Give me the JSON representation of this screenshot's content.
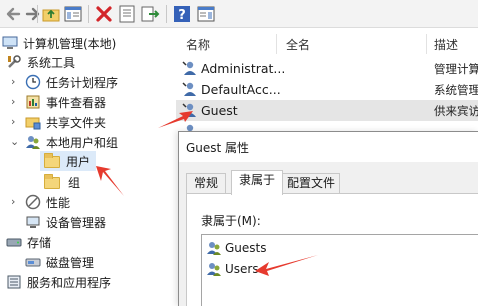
{
  "toolbar": {
    "icons": [
      "back-icon",
      "forward-icon",
      "up-folder-icon",
      "show-hide-tree-icon",
      "delete-icon",
      "properties-icon",
      "export-list-icon",
      "help-icon",
      "show-hide-action-pane-icon"
    ]
  },
  "tree": {
    "root": "计算机管理(本地)",
    "system_tools": "系统工具",
    "task_scheduler": "任务计划程序",
    "event_viewer": "事件查看器",
    "shared_folders": "共享文件夹",
    "local_users_groups": "本地用户和组",
    "users_folder": "用户",
    "groups_folder": "组",
    "performance": "性能",
    "device_manager": "设备管理器",
    "storage": "存储",
    "disk_management": "磁盘管理",
    "services_apps": "服务和应用程序"
  },
  "list": {
    "headers": {
      "name": "名称",
      "fullname": "全名",
      "desc": "描述"
    },
    "rows": [
      {
        "name": "Administrat...",
        "desc": "管理计算"
      },
      {
        "name": "DefaultAcc...",
        "desc": "系统管理"
      },
      {
        "name": "Guest",
        "desc": "供来宾访"
      }
    ]
  },
  "dialog": {
    "title": "Guest 属性",
    "tabs": {
      "general": "常规",
      "member_of": "隶属于",
      "profile": "配置文件"
    },
    "member_of_label": "隶属于(M):",
    "members": [
      "Guests",
      "Users"
    ]
  },
  "colors": {
    "annotation_arrow": "#e63a2e",
    "selection": "#dceaf9"
  }
}
